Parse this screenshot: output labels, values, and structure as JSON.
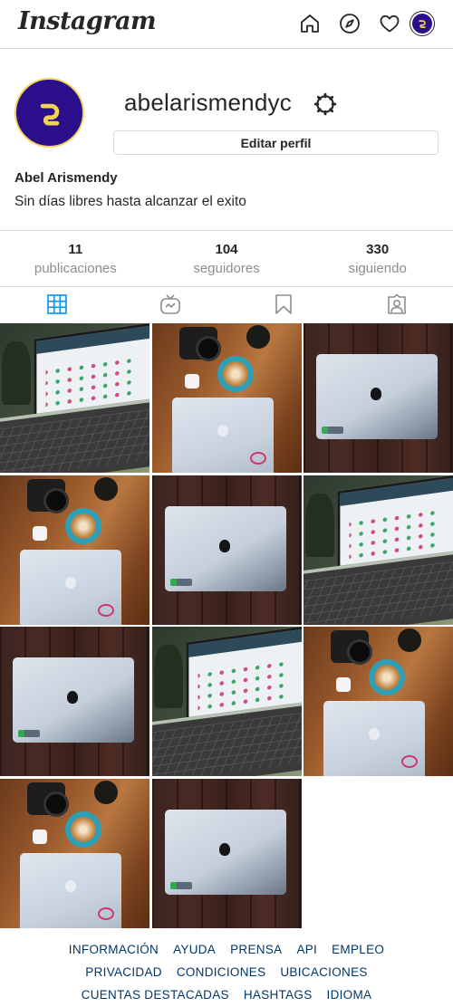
{
  "header": {
    "logo": "Instagram",
    "icons": [
      "home-icon",
      "explore-icon",
      "heart-icon",
      "profile-avatar"
    ]
  },
  "profile": {
    "username": "abelarismendyc",
    "edit_button": "Editar perfil",
    "full_name": "Abel Arismendy",
    "bio": "Sin días libres hasta alcanzar el exito",
    "avatar_color": "#2a0e8a",
    "avatar_ring_color": "#f2d15b"
  },
  "stats": [
    {
      "value": "11",
      "label": "publicaciones"
    },
    {
      "value": "104",
      "label": "seguidores"
    },
    {
      "value": "330",
      "label": "siguiendo"
    }
  ],
  "tabs": [
    {
      "icon": "grid-icon",
      "active": true
    },
    {
      "icon": "igtv-icon",
      "active": false
    },
    {
      "icon": "saved-icon",
      "active": false
    },
    {
      "icon": "tagged-icon",
      "active": false
    }
  ],
  "posts": [
    {
      "type": "laptop-website"
    },
    {
      "type": "coffee-camera-laptop"
    },
    {
      "type": "closed-laptop"
    },
    {
      "type": "coffee-camera-laptop"
    },
    {
      "type": "closed-laptop"
    },
    {
      "type": "laptop-website"
    },
    {
      "type": "closed-laptop"
    },
    {
      "type": "laptop-website"
    },
    {
      "type": "coffee-camera-laptop"
    },
    {
      "type": "coffee-camera-laptop"
    },
    {
      "type": "closed-laptop"
    }
  ],
  "footer": {
    "rows": [
      [
        "INFORMACIÓN",
        "AYUDA",
        "PRENSA",
        "API",
        "EMPLEO"
      ],
      [
        "PRIVACIDAD",
        "CONDICIONES",
        "UBICACIONES"
      ],
      [
        "CUENTAS DESTACADAS",
        "HASHTAGS",
        "IDIOMA"
      ]
    ]
  },
  "colors": {
    "text": "#262626",
    "secondary": "#8e8e8e",
    "border": "#dbdbdb",
    "link": "#00376b",
    "active_tab": "#0095f6"
  }
}
